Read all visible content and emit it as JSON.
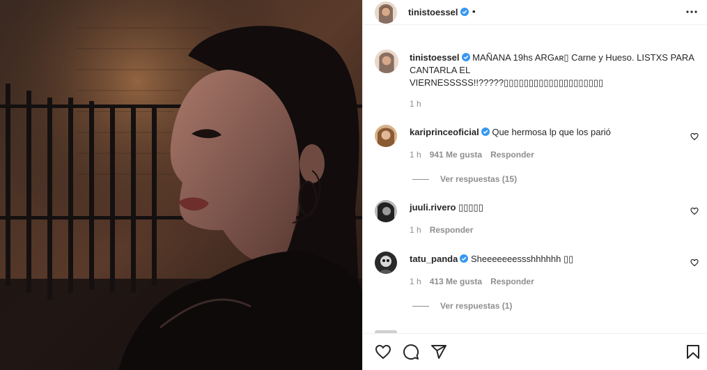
{
  "post": {
    "username": "tinistoessel",
    "dot": "•",
    "caption_user": "tinistoessel",
    "caption_text_1": "MAÑANA 19hs ARGᴀʀ▯ Carne y Hueso. LISTXS PARA",
    "caption_text_2": "CANTARLA EL",
    "caption_text_3": "VIERNESSSSS!!?????▯▯▯▯▯▯▯▯▯▯▯▯▯▯▯▯▯▯▯▯",
    "caption_time": "1 h"
  },
  "comments": [
    {
      "username": "kariprinceoficial",
      "verified": true,
      "text": "Que hermosa lp que los parió",
      "time": "1 h",
      "likes": "941 Me gusta",
      "reply": "Responder",
      "view_replies": "Ver respuestas (15)"
    },
    {
      "username": "juuli.rivero",
      "verified": false,
      "text": "▯▯▯▯▯",
      "time": "1 h",
      "likes": "",
      "reply": "Responder",
      "view_replies": ""
    },
    {
      "username": "tatu_panda",
      "verified": true,
      "text": "Sheeeeeeessshhhhhh ▯▯",
      "time": "1 h",
      "likes": "413 Me gusta",
      "reply": "Responder",
      "view_replies": "Ver respuestas (1)"
    }
  ],
  "icons": {
    "more": "more-options-icon",
    "verified": "verified-badge-icon",
    "like": "heart-icon",
    "comment": "comment-icon",
    "share": "share-icon",
    "save": "bookmark-icon"
  },
  "colors": {
    "verified": "#3897f0",
    "text": "#262626",
    "muted": "#8e8e8e"
  }
}
